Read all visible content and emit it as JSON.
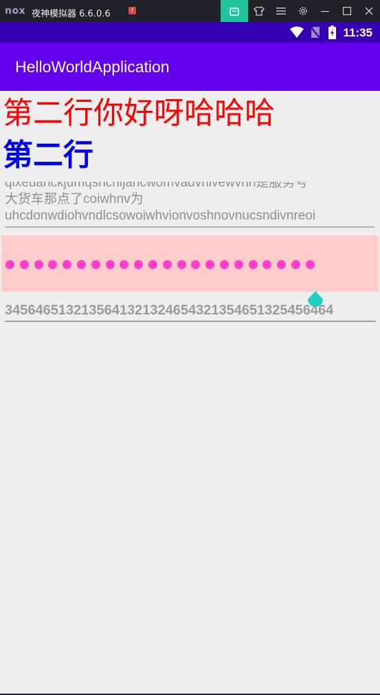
{
  "emulator": {
    "logo": "nox",
    "title": "夜神模拟器 6.6.0.6",
    "alert_icon": "alert-icon",
    "toolbar": {
      "store_icon": "bag-icon",
      "skin_icon": "shirt-icon",
      "menu_icon": "menu-icon",
      "settings_icon": "gear-icon",
      "minimize_icon": "minimize-icon",
      "maximize_icon": "maximize-icon",
      "close_icon": "close-icon"
    },
    "accent": "#1fc49a"
  },
  "status_bar": {
    "time": "11:35",
    "icons": [
      "wifi-icon",
      "no-sim-icon",
      "battery-icon"
    ],
    "color": "#3700b3"
  },
  "app_bar": {
    "title": "HelloWorldApplication",
    "color": "#6200ee"
  },
  "content": {
    "line_red": "第二行你好呀哈哈哈",
    "line_red_color": "#ff0000",
    "line_blue": "第二行",
    "line_blue_color": "#0000ee",
    "multiline_lines": [
      "qixeuancκjumqshchijancwomvadvnivewvnn是服务号",
      "大货车那点了coiwhnv为",
      "uhcdonwdiohvndlcsowojwhvionvoshnovnucsndivnreoi"
    ],
    "password_dot_count": 22,
    "password_bg": "#ffcccc",
    "password_dot_color": "#ff3fc9",
    "number_value": "3456465132135641321324654321354651325456464",
    "cursor_handle_color": "#1fd0c0"
  }
}
